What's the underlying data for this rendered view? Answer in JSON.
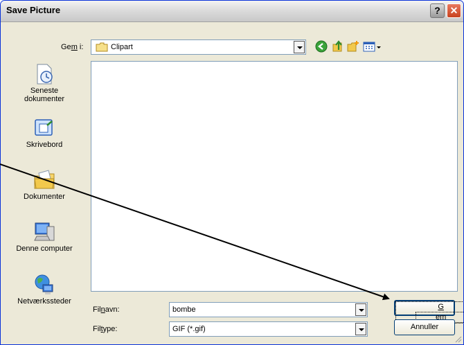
{
  "window": {
    "title": "Save Picture",
    "help_label": "?",
    "close_label": "✕"
  },
  "savein": {
    "label_pre": "Ge",
    "label_accel": "m",
    "label_post": " i:",
    "value": "Clipart"
  },
  "toolbar": {
    "icons": [
      "back-icon",
      "up-folder-icon",
      "new-folder-icon",
      "views-menu-icon"
    ]
  },
  "places": [
    {
      "line1": "Seneste",
      "line2": "dokumenter",
      "icon": "recent-documents-icon"
    },
    {
      "line1": "Skrivebord",
      "line2": "",
      "icon": "desktop-icon"
    },
    {
      "line1": "Dokumenter",
      "line2": "",
      "icon": "my-documents-icon"
    },
    {
      "line1": "Denne computer",
      "line2": "",
      "icon": "my-computer-icon"
    },
    {
      "line1": "Netværkssteder",
      "line2": "",
      "icon": "network-places-icon"
    }
  ],
  "filename": {
    "label_pre": "Fil",
    "label_accel": "n",
    "label_post": "avn:",
    "value": "bombe"
  },
  "filetype": {
    "label_pre": "Fil",
    "label_accel": "t",
    "label_post": "ype:",
    "value": "GIF (*.gif)"
  },
  "buttons": {
    "save_accel": "G",
    "save_rest": "em",
    "cancel": "Annuller"
  },
  "colors": {
    "title_bar": "#dcdcdc",
    "dialog_bg": "#ece9d8",
    "close_button": "#c8421e",
    "field_border": "#7f9db9"
  }
}
